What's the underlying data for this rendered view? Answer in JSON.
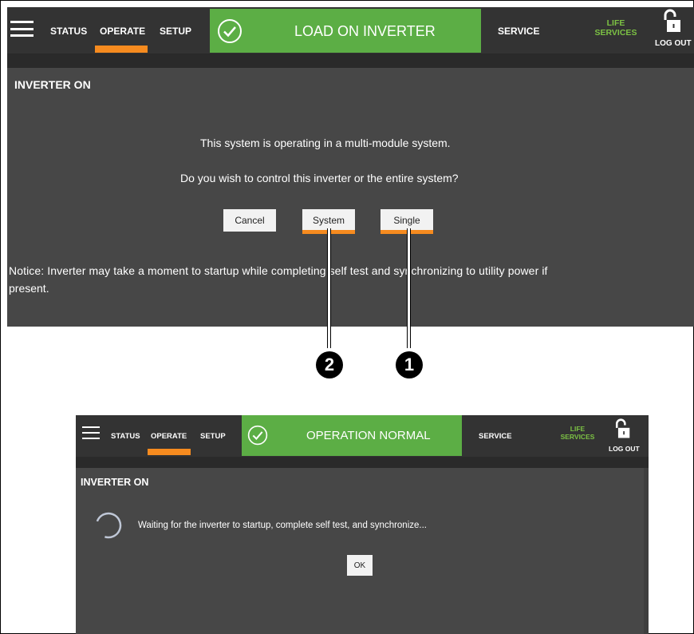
{
  "top_screen": {
    "nav": {
      "status": "STATUS",
      "operate": "OPERATE",
      "setup": "SETUP",
      "banner": "LOAD ON INVERTER",
      "service": "SERVICE",
      "life_services_line1": "LIFE",
      "life_services_line2": "SERVICES",
      "logout": "LOG OUT"
    },
    "panel_title": "INVERTER ON",
    "message_1": "This system is operating in a multi-module system.",
    "message_2": "Do you wish to control this inverter or the entire system?",
    "buttons": {
      "cancel": "Cancel",
      "system": "System",
      "single": "Single"
    },
    "notice_line1": "Notice: Inverter may take a moment to startup while completing self test and synchronizing to utility power if",
    "notice_line2": "present."
  },
  "callouts": {
    "system_marker": "2",
    "single_marker": "1"
  },
  "bottom_screen": {
    "nav": {
      "status": "STATUS",
      "operate": "OPERATE",
      "setup": "SETUP",
      "banner": "OPERATION NORMAL",
      "service": "SERVICE",
      "life_services_line1": "LIFE",
      "life_services_line2": "SERVICES",
      "logout": "LOG OUT"
    },
    "panel_title": "INVERTER ON",
    "waiting_message": "Waiting for the inverter to startup, complete self test, and synchronize...",
    "ok_button": "OK"
  },
  "colors": {
    "banner_green": "#5cae45",
    "accent_orange": "#f68b1f",
    "life_services_green": "#7cc144",
    "panel_gray": "#474747",
    "nav_gray": "#333333"
  }
}
